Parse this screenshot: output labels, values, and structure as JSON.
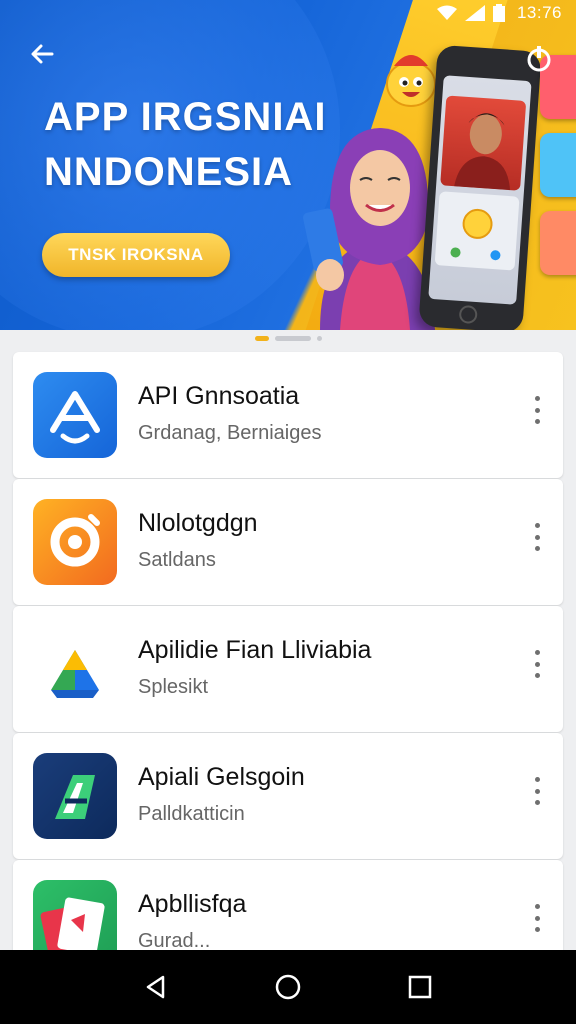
{
  "status_bar": {
    "time": "13:76"
  },
  "hero": {
    "title_line1": "APP IRGSNIAI",
    "title_line2": "NNDONESIA",
    "button_label": "TNSK IROKSNA"
  },
  "apps": [
    {
      "name": "API Gnnsoatia",
      "subtitle": "Grdanag, Berniaiges",
      "icon": "app-blue-a-icon"
    },
    {
      "name": "Nlolotgdgn",
      "subtitle": "Satldans",
      "icon": "app-orange-ring-icon"
    },
    {
      "name": "Apilidie Fian Lliviabia",
      "subtitle": "Splesikt",
      "icon": "app-triangle-icon"
    },
    {
      "name": "Apiali Gelsgoin",
      "subtitle": "Palldkatticin",
      "icon": "app-navy-a-icon"
    },
    {
      "name": "Apbllisfqa",
      "subtitle": "Gurad...",
      "icon": "app-green-card-icon"
    }
  ],
  "colors": {
    "hero_blue": "#1565d8",
    "hero_yellow": "#f7c21f",
    "accent": "#f2b21b"
  }
}
